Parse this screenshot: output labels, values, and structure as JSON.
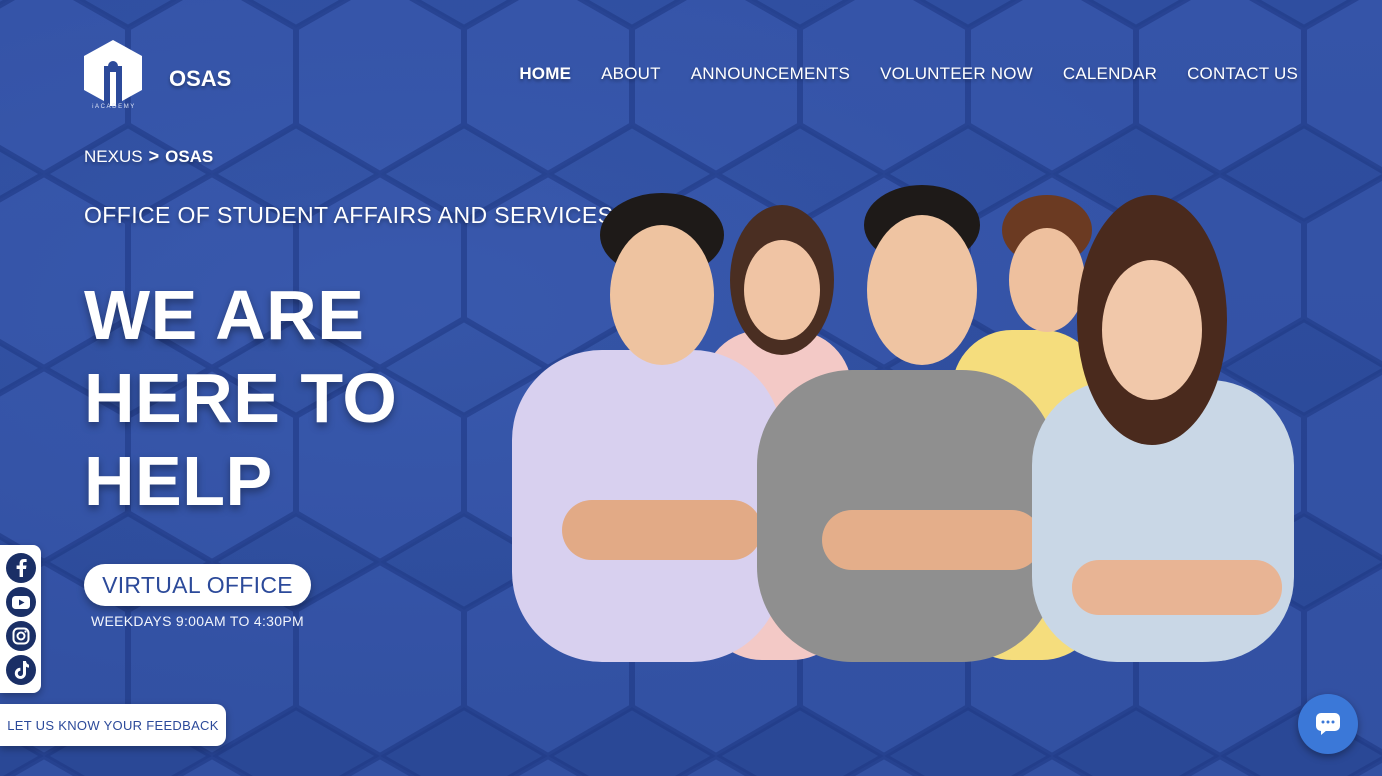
{
  "header": {
    "logo_text": "iACADEMY",
    "brand": "OSAS",
    "nav": [
      {
        "label": "HOME",
        "active": true
      },
      {
        "label": "ABOUT",
        "active": false
      },
      {
        "label": "ANNOUNCEMENTS",
        "active": false
      },
      {
        "label": "VOLUNTEER NOW",
        "active": false
      },
      {
        "label": "CALENDAR",
        "active": false
      },
      {
        "label": "CONTACT US",
        "active": false
      }
    ]
  },
  "breadcrumb": {
    "parent": "NEXUS",
    "separator": ">",
    "current": "OSAS"
  },
  "hero": {
    "subtitle": "OFFICE OF STUDENT AFFAIRS AND SERVICES",
    "heading_lines": [
      "WE ARE",
      "HERE TO",
      "HELP"
    ],
    "cta_label": "VIRTUAL OFFICE",
    "hours": "WEEKDAYS 9:00AM TO 4:30PM"
  },
  "social": [
    {
      "name": "facebook-icon"
    },
    {
      "name": "youtube-icon"
    },
    {
      "name": "instagram-icon"
    },
    {
      "name": "tiktok-icon"
    }
  ],
  "feedback_label": "LET US KNOW YOUR FEEDBACK",
  "colors": {
    "background": "#2c4a9a",
    "accent": "#3b78d8",
    "icon_dark": "#1a2f66"
  }
}
